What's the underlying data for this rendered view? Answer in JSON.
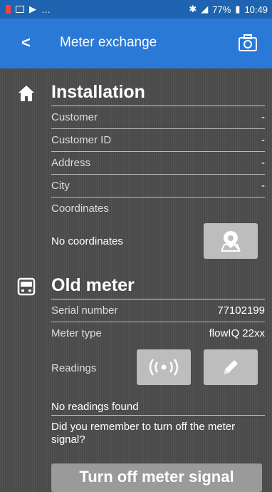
{
  "status_bar": {
    "left_text": "…",
    "battery": "77%",
    "time": "10:49"
  },
  "app_bar": {
    "back_label": "<",
    "title": "Meter exchange",
    "camera_icon": "camera-icon"
  },
  "installation": {
    "title": "Installation",
    "icon": "home-icon",
    "fields": [
      {
        "label": "Customer",
        "value": "-"
      },
      {
        "label": "Customer ID",
        "value": "-"
      },
      {
        "label": "Address",
        "value": "-"
      },
      {
        "label": "City",
        "value": "-"
      },
      {
        "label": "Coordinates",
        "value": ""
      }
    ],
    "no_coordinates": "No coordinates",
    "map_button_icon": "map-pin-icon"
  },
  "old_meter": {
    "title": "Old meter",
    "icon": "meter-icon",
    "serial_label": "Serial number",
    "serial_value": "77102199",
    "type_label": "Meter type",
    "type_value": "flowIQ 22xx",
    "readings_label": "Readings",
    "read_button_icon": "wireless-read-icon",
    "edit_button_icon": "pencil-icon",
    "no_readings": "No readings found",
    "reminder": "Did you remember to turn off the meter signal?",
    "turn_off_button": "Turn off meter signal"
  }
}
